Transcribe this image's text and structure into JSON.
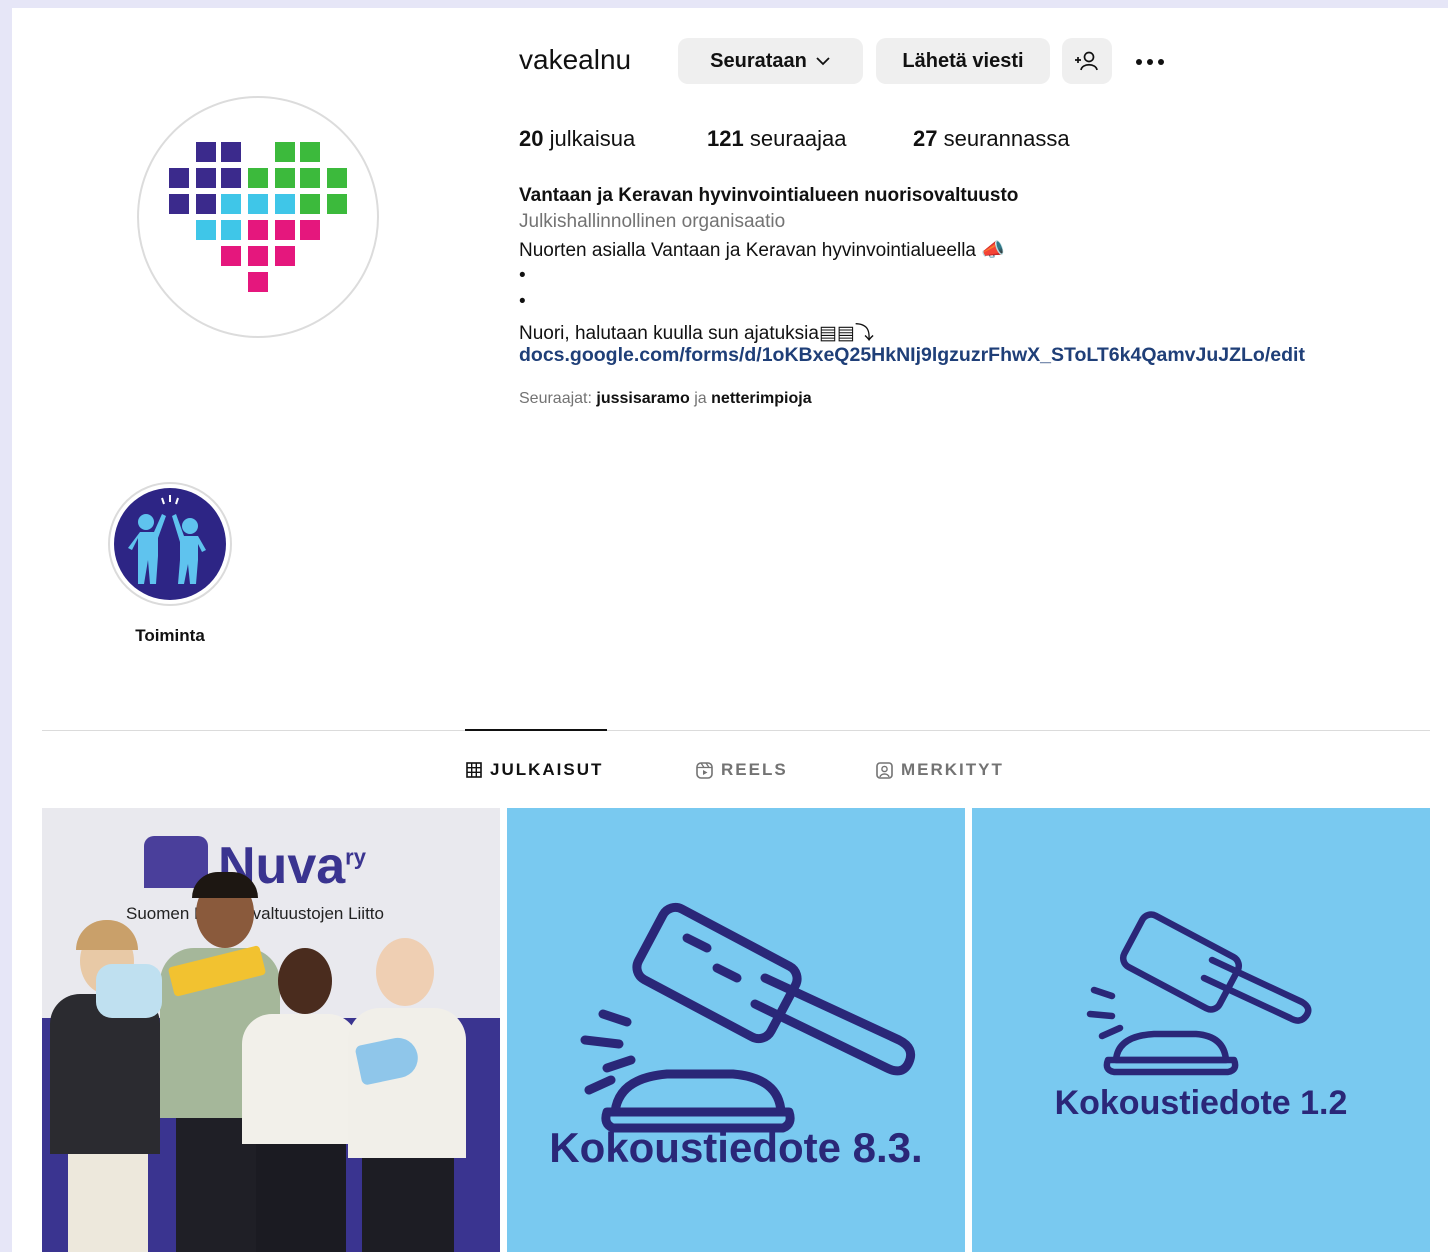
{
  "profile": {
    "username": "vakealnu",
    "follow_button": "Seurataan",
    "message_button": "Lähetä viesti",
    "stats": [
      {
        "count": "20",
        "label": "julkaisua"
      },
      {
        "count": "121",
        "label": "seuraajaa"
      },
      {
        "count": "27",
        "label": "seurannassa"
      }
    ],
    "name": "Vantaan ja Keravan hyvinvointialueen nuorisovaltuusto",
    "category": "Julkishallinnollinen organisaatio",
    "bio_line1": "Nuorten asialla Vantaan ja Keravan hyvinvointialueella 📣",
    "bio_dot1": "•",
    "bio_dot2": "•",
    "bio_line2": "Nuori, halutaan kuulla sun ajatuksia",
    "bio_line2_symbols": "▤▤⤵",
    "link": "docs.google.com/forms/d/1oKBxeQ25HkNIj9lgzuzrFhwX_SToLT6k4QamvJuJZLo/edit",
    "followers_prefix": "Seuraajat:",
    "follower1": "jussisaramo",
    "followers_joiner": "ja",
    "follower2": "netterimpioja"
  },
  "highlights": [
    {
      "label": "Toiminta"
    }
  ],
  "tabs": [
    {
      "label": "JULKAISUT",
      "active": true
    },
    {
      "label": "REELS",
      "active": false
    },
    {
      "label": "MERKITYT",
      "active": false
    }
  ],
  "posts": [
    {
      "banner_brand": "Nuva",
      "banner_suffix": "ry",
      "banner_sub": "Suomen Nuorisovaltuustojen Liitto"
    },
    {
      "caption": "Kokoustiedote 8.3."
    },
    {
      "caption": "Kokoustiedote 1.2"
    }
  ],
  "colors": {
    "accent_link": "#1f3f78",
    "tile_blue": "#79c9f0",
    "gavel_navy": "#2a2778"
  }
}
